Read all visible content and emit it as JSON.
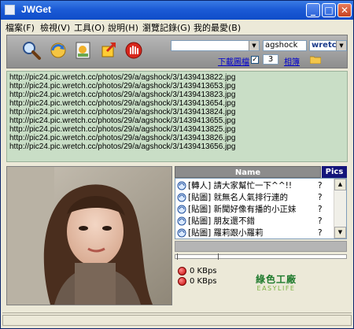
{
  "window": {
    "title": "JWGet"
  },
  "menu": [
    "檔案(F)",
    "檢視(V)",
    "工具(O)",
    "說明(H)",
    "瀏覽記錄(G)",
    "我的最愛(B)"
  ],
  "toolbar": {
    "search_value": "",
    "user_value": "agshock",
    "site_value": "wretch",
    "download_label": "下載圖檔",
    "download_checked": true,
    "count_value": "3",
    "album_label": "相簿"
  },
  "urls": [
    "http://pic24.pic.wretch.cc/photos/29/a/agshock/3/1439413822.jpg",
    "http://pic24.pic.wretch.cc/photos/29/a/agshock/3/1439413653.jpg",
    "http://pic24.pic.wretch.cc/photos/29/a/agshock/3/1439413823.jpg",
    "http://pic24.pic.wretch.cc/photos/29/a/agshock/3/1439413654.jpg",
    "http://pic24.pic.wretch.cc/photos/29/a/agshock/3/1439413824.jpg",
    "http://pic24.pic.wretch.cc/photos/29/a/agshock/3/1439413655.jpg",
    "http://pic24.pic.wretch.cc/photos/29/a/agshock/3/1439413825.jpg",
    "http://pic24.pic.wretch.cc/photos/29/a/agshock/3/1439413826.jpg",
    "http://pic24.pic.wretch.cc/photos/29/a/agshock/3/1439413656.jpg"
  ],
  "album_table": {
    "headers": {
      "name": "Name",
      "pics": "Pics"
    },
    "rows": [
      {
        "name": "[轉人] 請大家幫忙一下^^!!",
        "pics": "?"
      },
      {
        "name": "[貼圖] 就無名人氣排行連的",
        "pics": "?"
      },
      {
        "name": "[貼圖] 新聞好像有播的小正妹",
        "pics": "?"
      },
      {
        "name": "[貼圖] 朋友還不錯",
        "pics": "?"
      },
      {
        "name": "[貼圖] 羅莉跟小羅莉",
        "pics": "?"
      }
    ]
  },
  "progress": 0,
  "speeds": [
    "0 KBps",
    "0 KBps"
  ],
  "logo": {
    "cn": "綠色工廠",
    "en": "EASYLIFE"
  },
  "colors": {
    "titlebar": "#0f4cc8",
    "url_bg": "#c9dec6",
    "header_pics": "#14147a"
  }
}
